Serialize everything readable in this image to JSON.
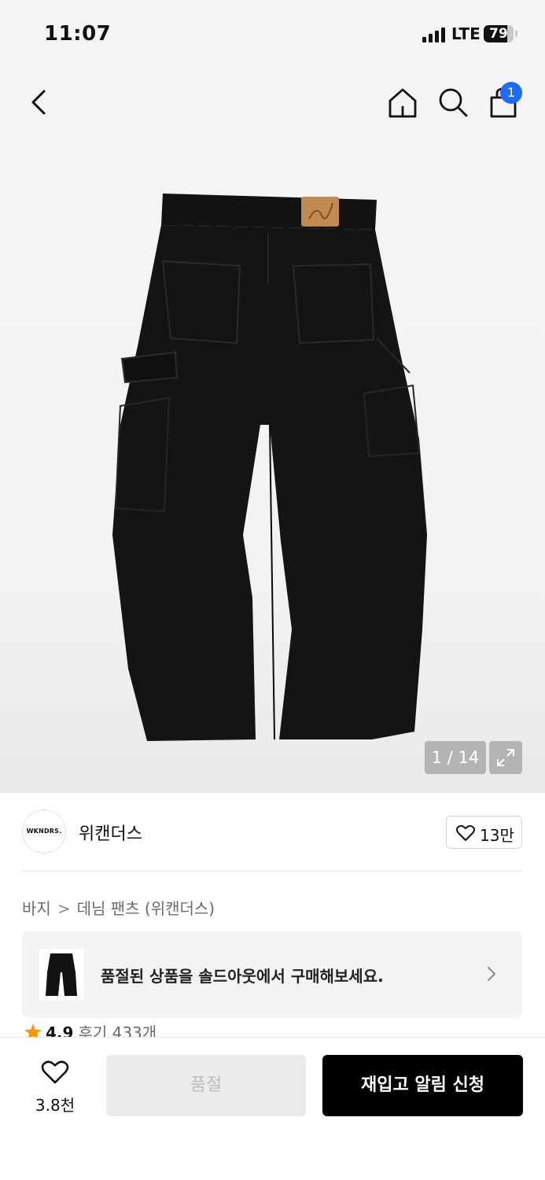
{
  "status_bar": {
    "time": "11:07",
    "network": "LTE",
    "battery": "79",
    "battery_level": 0.79
  },
  "header": {
    "cart_badge": "1"
  },
  "gallery": {
    "counter": "1 / 14"
  },
  "brand": {
    "logo_text": "WKNDRS.",
    "name": "위캔더스",
    "like_count": "13만"
  },
  "breadcrumb": {
    "items": [
      "바지",
      "데님 팬츠 (위캔더스)"
    ],
    "separator": ">"
  },
  "soldout_banner": {
    "text": "품절된 상품을 솔드아웃에서 구매해보세요."
  },
  "rating": {
    "score": "4.9",
    "reviews": "후기 433개"
  },
  "bottom_bar": {
    "wish_count": "3.8천",
    "soldout_label": "품절",
    "restock_label": "재입고 알림 신청"
  },
  "colors": {
    "accent_badge": "#1f6bff",
    "primary_button": "#000000",
    "disabled_button": "#ebebeb",
    "star": "#ff9500"
  }
}
